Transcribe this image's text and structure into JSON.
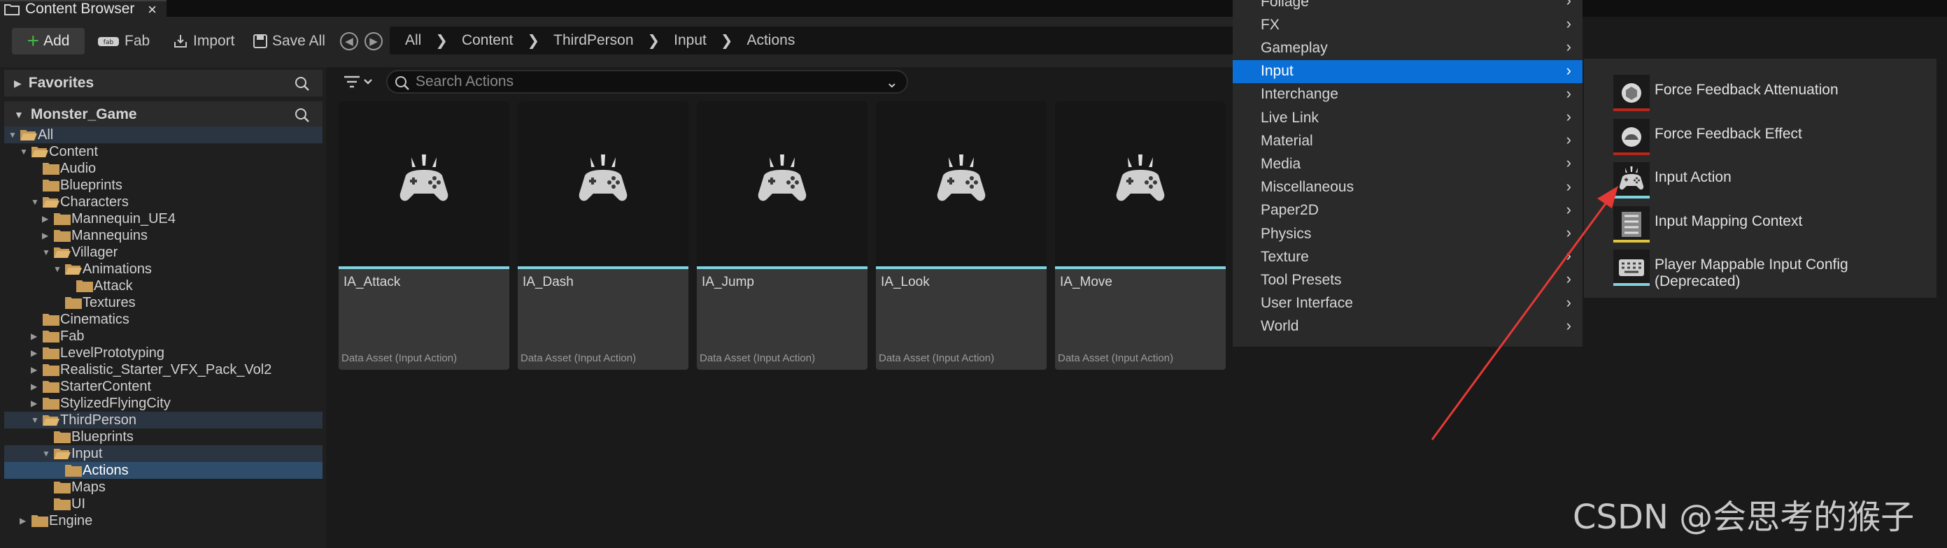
{
  "tab": {
    "title": "Content Browser",
    "close": "×"
  },
  "toolbar": {
    "add": "Add",
    "fab": "Fab",
    "import": "Import",
    "save_all": "Save All"
  },
  "breadcrumbs": [
    "All",
    "Content",
    "ThirdPerson",
    "Input",
    "Actions"
  ],
  "panels": {
    "favorites": "Favorites",
    "project": "Monster_Game"
  },
  "tree": [
    {
      "label": "All",
      "depth": 0,
      "expanded": true
    },
    {
      "label": "Content",
      "depth": 1,
      "expanded": true
    },
    {
      "label": "Audio",
      "depth": 2
    },
    {
      "label": "Blueprints",
      "depth": 2
    },
    {
      "label": "Characters",
      "depth": 2,
      "expanded": true
    },
    {
      "label": "Mannequin_UE4",
      "depth": 3,
      "collapsed": true
    },
    {
      "label": "Mannequins",
      "depth": 3,
      "collapsed": true
    },
    {
      "label": "Villager",
      "depth": 3,
      "expanded": true
    },
    {
      "label": "Animations",
      "depth": 4,
      "expanded": true
    },
    {
      "label": "Attack",
      "depth": 5
    },
    {
      "label": "Textures",
      "depth": 4
    },
    {
      "label": "Cinematics",
      "depth": 2
    },
    {
      "label": "Fab",
      "depth": 2,
      "collapsed": true
    },
    {
      "label": "LevelPrototyping",
      "depth": 2,
      "collapsed": true
    },
    {
      "label": "Realistic_Starter_VFX_Pack_Vol2",
      "depth": 2,
      "collapsed": true
    },
    {
      "label": "StarterContent",
      "depth": 2,
      "collapsed": true
    },
    {
      "label": "StylizedFlyingCity",
      "depth": 2,
      "collapsed": true
    },
    {
      "label": "ThirdPerson",
      "depth": 2,
      "expanded": true
    },
    {
      "label": "Blueprints",
      "depth": 3
    },
    {
      "label": "Input",
      "depth": 3,
      "expanded": true
    },
    {
      "label": "Actions",
      "depth": 4
    },
    {
      "label": "Maps",
      "depth": 3
    },
    {
      "label": "UI",
      "depth": 3
    },
    {
      "label": "Engine",
      "depth": 1,
      "collapsed": true
    }
  ],
  "search": {
    "placeholder": "Search Actions"
  },
  "assets": [
    {
      "name": "IA_Attack",
      "type": "Data Asset (Input Action)"
    },
    {
      "name": "IA_Dash",
      "type": "Data Asset (Input Action)"
    },
    {
      "name": "IA_Jump",
      "type": "Data Asset (Input Action)"
    },
    {
      "name": "IA_Look",
      "type": "Data Asset (Input Action)"
    },
    {
      "name": "IA_Move",
      "type": "Data Asset (Input Action)"
    }
  ],
  "menu": [
    "Foliage",
    "FX",
    "Gameplay",
    "Input",
    "Interchange",
    "Live Link",
    "Material",
    "Media",
    "Miscellaneous",
    "Paper2D",
    "Physics",
    "Texture",
    "Tool Presets",
    "User Interface",
    "World"
  ],
  "submenu": [
    {
      "label": "Force Feedback Attenuation",
      "color": "#b3271c"
    },
    {
      "label": "Force Feedback Effect",
      "color": "#b3271c"
    },
    {
      "label": "Input Action",
      "color": "#7fd3de"
    },
    {
      "label": "Input Mapping Context",
      "color": "#e0c341"
    },
    {
      "label": "Player Mappable Input Config (Deprecated)",
      "color": "#7fd3de"
    }
  ],
  "watermark": "CSDN @会思考的猴子",
  "colors": {
    "accent": "#0a70d8",
    "folder": "#c79a56",
    "selection": "#2f4d6b",
    "annotation_arrow": "#e53935"
  }
}
